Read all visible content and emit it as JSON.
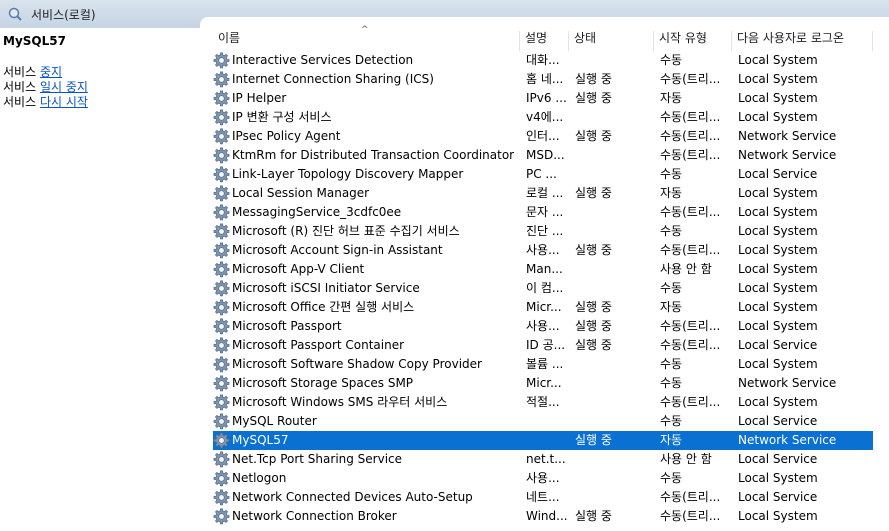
{
  "window": {
    "title": "서비스(로컬)"
  },
  "left": {
    "service_name": "MySQL57",
    "actions": [
      {
        "prefix": "서비스 ",
        "link": "중지"
      },
      {
        "prefix": "서비스 ",
        "link": "일시 중지"
      },
      {
        "prefix": "서비스 ",
        "link": "다시 시작"
      }
    ]
  },
  "columns": {
    "name": "이름",
    "desc": "설명",
    "status": "상태",
    "start": "시작 유형",
    "logon": "다음 사용자로 로그온"
  },
  "sort_indicator": "^",
  "rows": [
    {
      "name": "Interactive Services Detection",
      "desc": "대화...",
      "status": "",
      "start": "수동",
      "logon": "Local System"
    },
    {
      "name": "Internet Connection Sharing (ICS)",
      "desc": "홈 네...",
      "status": "실행 중",
      "start": "수동(트리...",
      "logon": "Local System"
    },
    {
      "name": "IP Helper",
      "desc": "IPv6 ...",
      "status": "실행 중",
      "start": "자동",
      "logon": "Local System"
    },
    {
      "name": "IP 변환 구성 서비스",
      "desc": "v4에...",
      "status": "",
      "start": "수동(트리...",
      "logon": "Local System"
    },
    {
      "name": "IPsec Policy Agent",
      "desc": "인터...",
      "status": "실행 중",
      "start": "수동(트리...",
      "logon": "Network Service"
    },
    {
      "name": "KtmRm for Distributed Transaction Coordinator",
      "desc": "MSD...",
      "status": "",
      "start": "수동(트리...",
      "logon": "Network Service"
    },
    {
      "name": "Link-Layer Topology Discovery Mapper",
      "desc": "PC ...",
      "status": "",
      "start": "수동",
      "logon": "Local Service"
    },
    {
      "name": "Local Session Manager",
      "desc": "로컬 ...",
      "status": "실행 중",
      "start": "자동",
      "logon": "Local System"
    },
    {
      "name": "MessagingService_3cdfc0ee",
      "desc": "문자 ...",
      "status": "",
      "start": "수동(트리...",
      "logon": "Local System"
    },
    {
      "name": "Microsoft (R) 진단 허브 표준 수집기 서비스",
      "desc": "진단 ...",
      "status": "",
      "start": "수동",
      "logon": "Local System"
    },
    {
      "name": "Microsoft Account Sign-in Assistant",
      "desc": "사용...",
      "status": "실행 중",
      "start": "수동(트리...",
      "logon": "Local System"
    },
    {
      "name": "Microsoft App-V Client",
      "desc": "Man...",
      "status": "",
      "start": "사용 안 함",
      "logon": "Local System"
    },
    {
      "name": "Microsoft iSCSI Initiator Service",
      "desc": "이 컴...",
      "status": "",
      "start": "수동",
      "logon": "Local System"
    },
    {
      "name": "Microsoft Office 간편 실행 서비스",
      "desc": "Micr...",
      "status": "실행 중",
      "start": "자동",
      "logon": "Local System"
    },
    {
      "name": "Microsoft Passport",
      "desc": "사용...",
      "status": "실행 중",
      "start": "수동(트리...",
      "logon": "Local System"
    },
    {
      "name": "Microsoft Passport Container",
      "desc": "ID 공...",
      "status": "실행 중",
      "start": "수동(트리...",
      "logon": "Local Service"
    },
    {
      "name": "Microsoft Software Shadow Copy Provider",
      "desc": "볼륨 ...",
      "status": "",
      "start": "수동",
      "logon": "Local System"
    },
    {
      "name": "Microsoft Storage Spaces SMP",
      "desc": "Micr...",
      "status": "",
      "start": "수동",
      "logon": "Network Service"
    },
    {
      "name": "Microsoft Windows SMS 라우터 서비스",
      "desc": "적절...",
      "status": "",
      "start": "수동(트리...",
      "logon": "Local System"
    },
    {
      "name": "MySQL Router",
      "desc": "",
      "status": "",
      "start": "수동",
      "logon": "Local Service"
    },
    {
      "name": "MySQL57",
      "desc": "",
      "status": "실행 중",
      "start": "자동",
      "logon": "Network Service",
      "selected": true
    },
    {
      "name": "Net.Tcp Port Sharing Service",
      "desc": "net.t...",
      "status": "",
      "start": "사용 안 함",
      "logon": "Local Service"
    },
    {
      "name": "Netlogon",
      "desc": "사용...",
      "status": "",
      "start": "수동",
      "logon": "Local System"
    },
    {
      "name": "Network Connected Devices Auto-Setup",
      "desc": "네트...",
      "status": "",
      "start": "수동(트리...",
      "logon": "Local Service"
    },
    {
      "name": "Network Connection Broker",
      "desc": "Wind...",
      "status": "실행 중",
      "start": "수동(트리...",
      "logon": "Local System"
    }
  ]
}
